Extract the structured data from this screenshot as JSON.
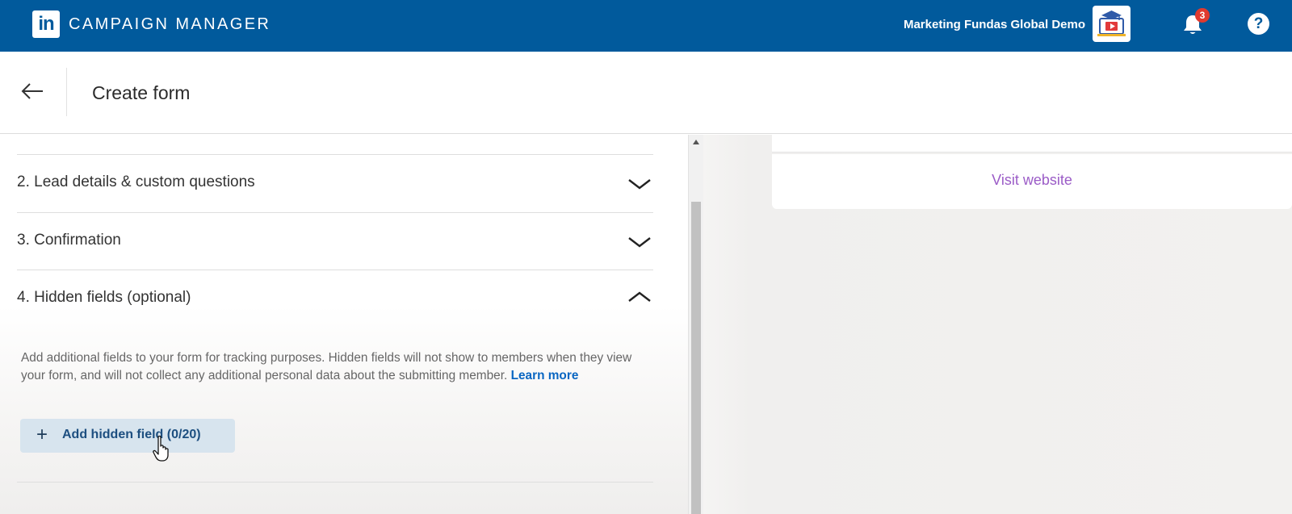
{
  "topbar": {
    "logo_text": "in",
    "app_title": "CAMPAIGN MANAGER",
    "account_name": "Marketing Fundas Global Demo",
    "notification_count": "3",
    "help_icon_text": "?",
    "background": "#015a9c"
  },
  "header": {
    "title": "Create form"
  },
  "form_sections": [
    {
      "label": "2.  Lead details & custom questions",
      "state": "collapsed"
    },
    {
      "label": "3.  Confirmation",
      "state": "collapsed"
    },
    {
      "label": "4.  Hidden fields (optional)",
      "state": "expanded"
    }
  ],
  "hidden_fields": {
    "description": "Add additional fields to your form for tracking purposes. Hidden fields will not show to members when they view your form, and will not collect any additional personal data about the submitting member.",
    "learn_more": "Learn more",
    "add_button_label": "Add hidden field (0/20)"
  },
  "preview": {
    "visit_website": "Visit website"
  },
  "colors": {
    "link_blue": "#0a66c2",
    "visit_link": "#9b5cc7",
    "badge_red": "#e03a2f"
  }
}
